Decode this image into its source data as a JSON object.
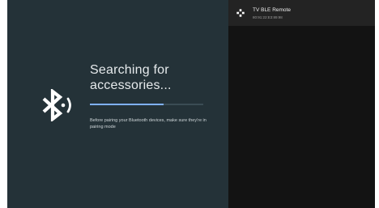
{
  "pairing": {
    "title": "Searching for accessories...",
    "instructions": "Before pairing your Bluetooth devices, make sure they're in pairing mode",
    "progress": 0.65,
    "icon": "bluetooth-searching-icon"
  },
  "devices": [
    {
      "name": "TV BLE Remote",
      "address": "80:91:22:E3:89:98",
      "icon": "gamepad-icon"
    }
  ],
  "colors": {
    "left_panel": "#243238",
    "right_panel": "#131313",
    "device_row": "#232323",
    "progress_fill": "#7fb1ff",
    "progress_track": "#3b4c54"
  }
}
